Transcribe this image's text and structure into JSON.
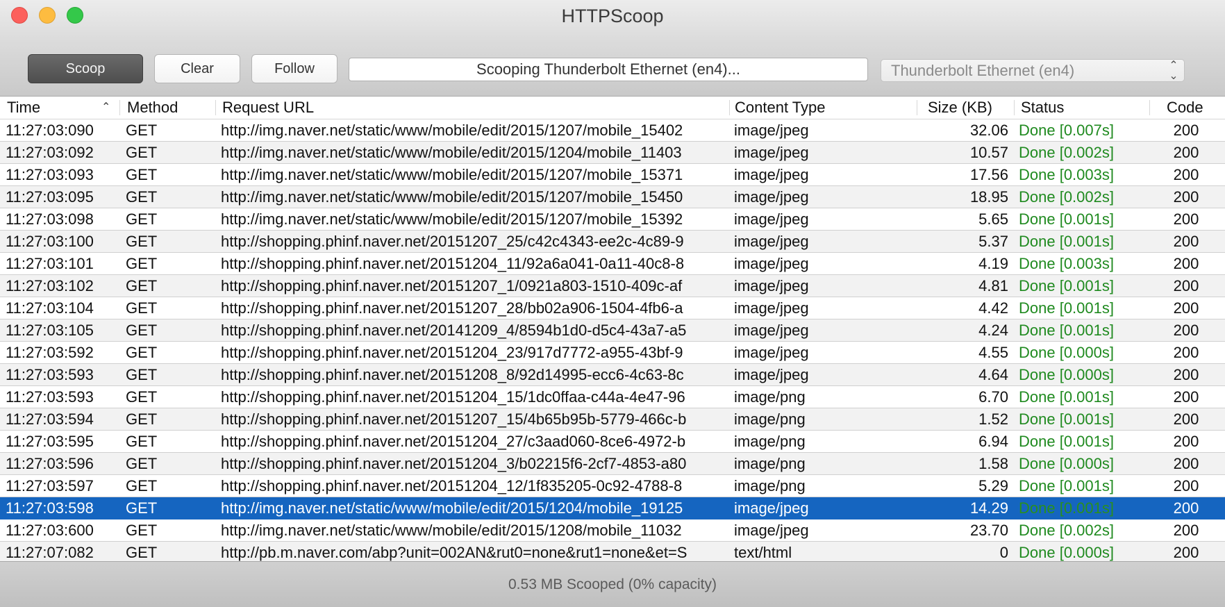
{
  "window": {
    "title": "HTTPScoop"
  },
  "toolbar": {
    "scoop_label": "Scoop",
    "clear_label": "Clear",
    "follow_label": "Follow",
    "status_text": "Scooping Thunderbolt Ethernet (en4)...",
    "interface_selected": "Thunderbolt Ethernet (en4)"
  },
  "table": {
    "columns": [
      "Time",
      "Method",
      "Request URL",
      "Content Type",
      "Size (KB)",
      "Status",
      "Code"
    ],
    "sort": {
      "column": "Time",
      "direction": "ascending"
    },
    "selected_row_index": 17,
    "rows": [
      {
        "time": "11:27:03:090",
        "method": "GET",
        "url": "http://img.naver.net/static/www/mobile/edit/2015/1207/mobile_15402",
        "content_type": "image/jpeg",
        "size": "32.06",
        "status": "Done [0.007s]",
        "code": "200"
      },
      {
        "time": "11:27:03:092",
        "method": "GET",
        "url": "http://img.naver.net/static/www/mobile/edit/2015/1204/mobile_11403",
        "content_type": "image/jpeg",
        "size": "10.57",
        "status": "Done [0.002s]",
        "code": "200"
      },
      {
        "time": "11:27:03:093",
        "method": "GET",
        "url": "http://img.naver.net/static/www/mobile/edit/2015/1207/mobile_15371",
        "content_type": "image/jpeg",
        "size": "17.56",
        "status": "Done [0.003s]",
        "code": "200"
      },
      {
        "time": "11:27:03:095",
        "method": "GET",
        "url": "http://img.naver.net/static/www/mobile/edit/2015/1207/mobile_15450",
        "content_type": "image/jpeg",
        "size": "18.95",
        "status": "Done [0.002s]",
        "code": "200"
      },
      {
        "time": "11:27:03:098",
        "method": "GET",
        "url": "http://img.naver.net/static/www/mobile/edit/2015/1207/mobile_15392",
        "content_type": "image/jpeg",
        "size": "5.65",
        "status": "Done [0.001s]",
        "code": "200"
      },
      {
        "time": "11:27:03:100",
        "method": "GET",
        "url": "http://shopping.phinf.naver.net/20151207_25/c42c4343-ee2c-4c89-9",
        "content_type": "image/jpeg",
        "size": "5.37",
        "status": "Done [0.001s]",
        "code": "200"
      },
      {
        "time": "11:27:03:101",
        "method": "GET",
        "url": "http://shopping.phinf.naver.net/20151204_11/92a6a041-0a11-40c8-8",
        "content_type": "image/jpeg",
        "size": "4.19",
        "status": "Done [0.003s]",
        "code": "200"
      },
      {
        "time": "11:27:03:102",
        "method": "GET",
        "url": "http://shopping.phinf.naver.net/20151207_1/0921a803-1510-409c-af",
        "content_type": "image/jpeg",
        "size": "4.81",
        "status": "Done [0.001s]",
        "code": "200"
      },
      {
        "time": "11:27:03:104",
        "method": "GET",
        "url": "http://shopping.phinf.naver.net/20151207_28/bb02a906-1504-4fb6-a",
        "content_type": "image/jpeg",
        "size": "4.42",
        "status": "Done [0.001s]",
        "code": "200"
      },
      {
        "time": "11:27:03:105",
        "method": "GET",
        "url": "http://shopping.phinf.naver.net/20141209_4/8594b1d0-d5c4-43a7-a5",
        "content_type": "image/jpeg",
        "size": "4.24",
        "status": "Done [0.001s]",
        "code": "200"
      },
      {
        "time": "11:27:03:592",
        "method": "GET",
        "url": "http://shopping.phinf.naver.net/20151204_23/917d7772-a955-43bf-9",
        "content_type": "image/jpeg",
        "size": "4.55",
        "status": "Done [0.000s]",
        "code": "200"
      },
      {
        "time": "11:27:03:593",
        "method": "GET",
        "url": "http://shopping.phinf.naver.net/20151208_8/92d14995-ecc6-4c63-8c",
        "content_type": "image/jpeg",
        "size": "4.64",
        "status": "Done [0.000s]",
        "code": "200"
      },
      {
        "time": "11:27:03:593",
        "method": "GET",
        "url": "http://shopping.phinf.naver.net/20151204_15/1dc0ffaa-c44a-4e47-96",
        "content_type": "image/png",
        "size": "6.70",
        "status": "Done [0.001s]",
        "code": "200"
      },
      {
        "time": "11:27:03:594",
        "method": "GET",
        "url": "http://shopping.phinf.naver.net/20151207_15/4b65b95b-5779-466c-b",
        "content_type": "image/png",
        "size": "1.52",
        "status": "Done [0.001s]",
        "code": "200"
      },
      {
        "time": "11:27:03:595",
        "method": "GET",
        "url": "http://shopping.phinf.naver.net/20151204_27/c3aad060-8ce6-4972-b",
        "content_type": "image/png",
        "size": "6.94",
        "status": "Done [0.001s]",
        "code": "200"
      },
      {
        "time": "11:27:03:596",
        "method": "GET",
        "url": "http://shopping.phinf.naver.net/20151204_3/b02215f6-2cf7-4853-a80",
        "content_type": "image/png",
        "size": "1.58",
        "status": "Done [0.000s]",
        "code": "200"
      },
      {
        "time": "11:27:03:597",
        "method": "GET",
        "url": "http://shopping.phinf.naver.net/20151204_12/1f835205-0c92-4788-8",
        "content_type": "image/png",
        "size": "5.29",
        "status": "Done [0.001s]",
        "code": "200"
      },
      {
        "time": "11:27:03:598",
        "method": "GET",
        "url": "http://img.naver.net/static/www/mobile/edit/2015/1204/mobile_19125",
        "content_type": "image/jpeg",
        "size": "14.29",
        "status": "Done [0.001s]",
        "code": "200"
      },
      {
        "time": "11:27:03:600",
        "method": "GET",
        "url": "http://img.naver.net/static/www/mobile/edit/2015/1208/mobile_11032",
        "content_type": "image/jpeg",
        "size": "23.70",
        "status": "Done [0.002s]",
        "code": "200"
      },
      {
        "time": "11:27:07:082",
        "method": "GET",
        "url": "http://pb.m.naver.com/abp?unit=002AN&rut0=none&rut1=none&et=S",
        "content_type": "text/html",
        "size": "0",
        "status": "Done [0.000s]",
        "code": "200"
      }
    ]
  },
  "footer": {
    "status_text": "0.53 MB Scooped (0% capacity)"
  },
  "colors": {
    "selection": "#1565c0",
    "status_done": "#1f8a1f",
    "scoop_button": "#555555",
    "close": "#fc605c",
    "minimize": "#fdbc40",
    "zoom": "#34c84a"
  },
  "icons": [
    "close-icon",
    "minimize-icon",
    "zoom-icon",
    "sort-ascending-icon",
    "chevron-updown-icon"
  ]
}
